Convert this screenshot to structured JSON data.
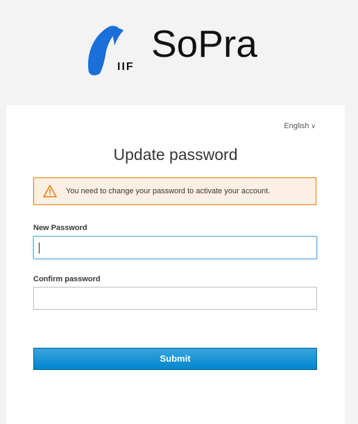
{
  "brand": {
    "logo_mark_text": "IIF",
    "name": "SoPra",
    "mark_color": "#1a6fd8"
  },
  "language": {
    "selected": "English",
    "chevron_icon": "chevron-down-icon"
  },
  "form": {
    "title": "Update password",
    "alert": {
      "icon": "warning-icon",
      "message": "You need to change your password to activate your account.",
      "background": "#fcefe4",
      "border": "#ec7a08"
    },
    "new_password_label": "New Password",
    "new_password_value": "",
    "confirm_password_label": "Confirm password",
    "confirm_password_value": "",
    "submit_label": "Submit",
    "submit_color": "#0085cf"
  }
}
